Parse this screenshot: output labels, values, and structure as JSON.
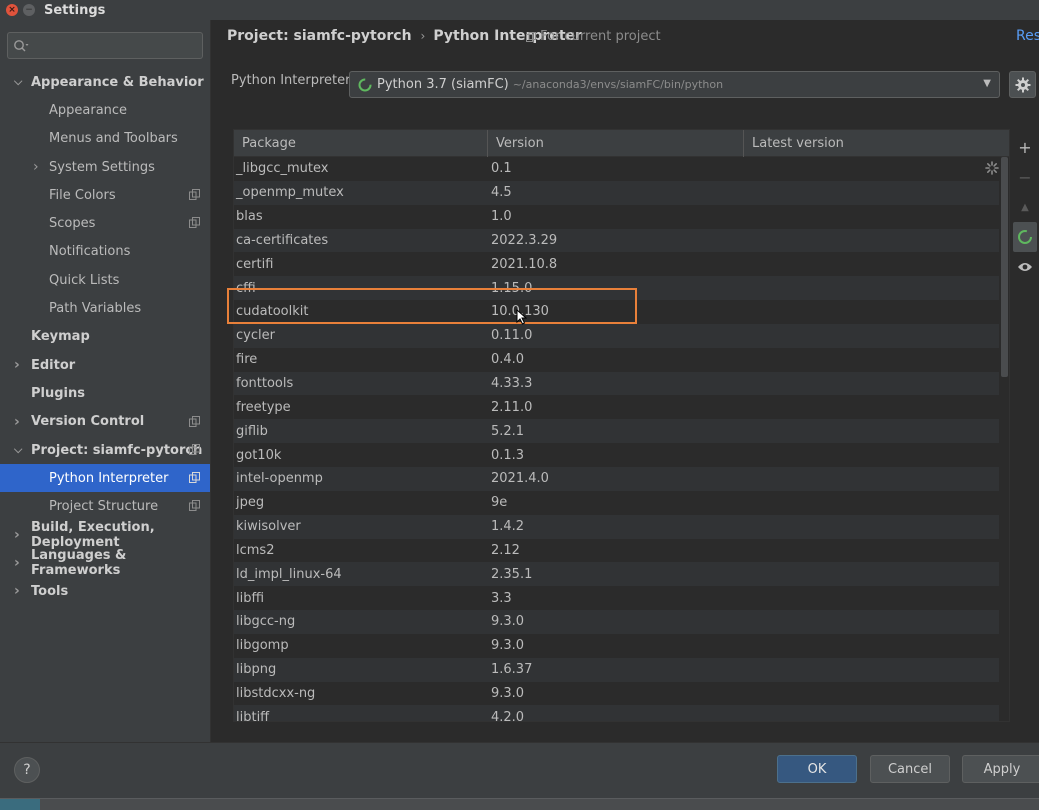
{
  "window": {
    "title": "Settings"
  },
  "sidebar": {
    "search_placeholder": "",
    "items": [
      {
        "label": "Appearance & Behavior",
        "level": 0,
        "expanded": true
      },
      {
        "label": "Appearance",
        "level": 1
      },
      {
        "label": "Menus and Toolbars",
        "level": 1
      },
      {
        "label": "System Settings",
        "level": 1,
        "collapsed": true
      },
      {
        "label": "File Colors",
        "level": 1,
        "copy": true
      },
      {
        "label": "Scopes",
        "level": 1,
        "copy": true
      },
      {
        "label": "Notifications",
        "level": 1
      },
      {
        "label": "Quick Lists",
        "level": 1
      },
      {
        "label": "Path Variables",
        "level": 1
      },
      {
        "label": "Keymap",
        "level": 0
      },
      {
        "label": "Editor",
        "level": 0,
        "collapsed": true
      },
      {
        "label": "Plugins",
        "level": 0
      },
      {
        "label": "Version Control",
        "level": 0,
        "collapsed": true,
        "copy": true
      },
      {
        "label": "Project: siamfc-pytorch",
        "level": 0,
        "expanded": true,
        "copy": true
      },
      {
        "label": "Python Interpreter",
        "level": 1,
        "selected": true,
        "copy": true
      },
      {
        "label": "Project Structure",
        "level": 1,
        "copy": true
      },
      {
        "label": "Build, Execution, Deployment",
        "level": 0,
        "collapsed": true
      },
      {
        "label": "Languages & Frameworks",
        "level": 0,
        "collapsed": true
      },
      {
        "label": "Tools",
        "level": 0,
        "collapsed": true
      }
    ]
  },
  "header": {
    "crumb_project": "Project: siamfc-pytorch",
    "crumb_page": "Python Interpreter",
    "for_current": "For current project",
    "reset": "Rese"
  },
  "interpreter": {
    "label": "Python Interpreter:",
    "name": "Python 3.7 (siamFC)",
    "path": "~/anaconda3/envs/siamFC/bin/python"
  },
  "table": {
    "columns": [
      "Package",
      "Version",
      "Latest version"
    ],
    "rows": [
      [
        "_libgcc_mutex",
        "0.1"
      ],
      [
        "_openmp_mutex",
        "4.5"
      ],
      [
        "blas",
        "1.0"
      ],
      [
        "ca-certificates",
        "2022.3.29"
      ],
      [
        "certifi",
        "2021.10.8"
      ],
      [
        "cffi",
        "1.15.0"
      ],
      [
        "cudatoolkit",
        "10.0.130"
      ],
      [
        "cycler",
        "0.11.0"
      ],
      [
        "fire",
        "0.4.0"
      ],
      [
        "fonttools",
        "4.33.3"
      ],
      [
        "freetype",
        "2.11.0"
      ],
      [
        "giflib",
        "5.2.1"
      ],
      [
        "got10k",
        "0.1.3"
      ],
      [
        "intel-openmp",
        "2021.4.0"
      ],
      [
        "jpeg",
        "9e"
      ],
      [
        "kiwisolver",
        "1.4.2"
      ],
      [
        "lcms2",
        "2.12"
      ],
      [
        "ld_impl_linux-64",
        "2.35.1"
      ],
      [
        "libffi",
        "3.3"
      ],
      [
        "libgcc-ng",
        "9.3.0"
      ],
      [
        "libgomp",
        "9.3.0"
      ],
      [
        "libpng",
        "1.6.37"
      ],
      [
        "libstdcxx-ng",
        "9.3.0"
      ],
      [
        "libtiff",
        "4.2.0"
      ]
    ],
    "highlighted_package": "cudatoolkit"
  },
  "tools": {
    "add": "+",
    "remove": "−",
    "upgrade": "▲"
  },
  "footer": {
    "help": "?",
    "ok": "OK",
    "cancel": "Cancel",
    "apply": "Apply"
  },
  "colors": {
    "accent": "#2f65ca",
    "highlight_box": "#e8803a",
    "link": "#589df6"
  }
}
